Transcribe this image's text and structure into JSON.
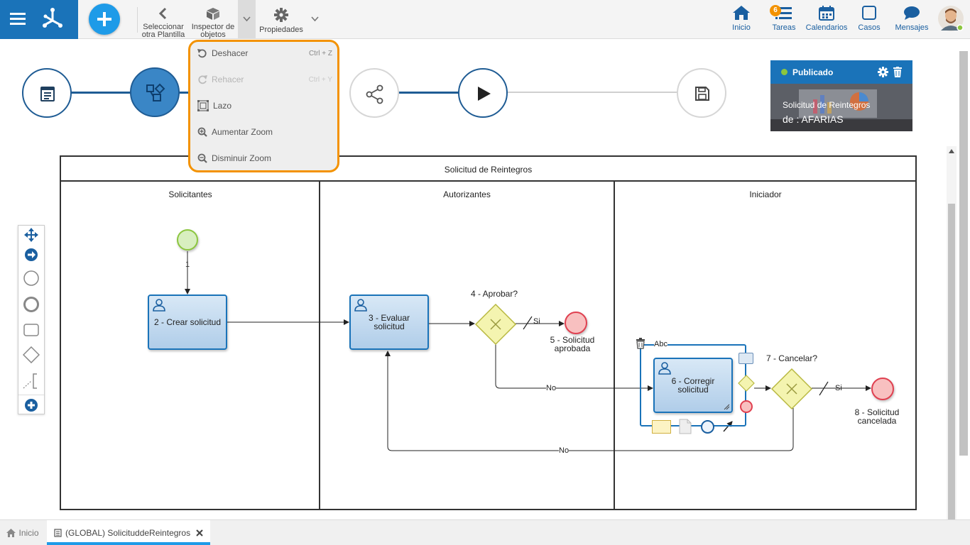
{
  "toolbar": {
    "select_template_label": "Seleccionar otra Plantilla",
    "object_inspector_label": "Inspector de objetos",
    "properties_label": "Propiedades"
  },
  "nav": {
    "home": "Inicio",
    "tasks": "Tareas",
    "tasks_badge": "6",
    "calendars": "Calendarios",
    "cases": "Casos",
    "messages": "Mensajes"
  },
  "edit_menu": {
    "items": [
      {
        "label": "Deshacer",
        "shortcut": "Ctrl + Z",
        "enabled": true
      },
      {
        "label": "Rehacer",
        "shortcut": "Ctrl + Y",
        "enabled": false
      },
      {
        "label": "Lazo",
        "shortcut": "",
        "enabled": true
      },
      {
        "label": "Aumentar Zoom",
        "shortcut": "",
        "enabled": true
      },
      {
        "label": "Disminuir Zoom",
        "shortcut": "",
        "enabled": true
      }
    ]
  },
  "publish_card": {
    "status": "Publicado",
    "title": "Solicitud de Reintegros",
    "author": "de : AFARIAS",
    "status_color": "#8cc63f"
  },
  "diagram": {
    "pool_title": "Solicitud de  Reintegros",
    "lanes": [
      "Solicitantes",
      "Autorizantes",
      "Iniciador"
    ],
    "start_event_label": "1",
    "task2": "2 - Crear solicitud",
    "task3_line1": "3 - Evaluar",
    "task3_line2": "solicitud",
    "gateway4": "4 - Aprobar?",
    "event5_line1": "5 - Solicitud",
    "event5_line2": "aprobada",
    "task6_line1": "6 - Corregir",
    "task6_line2": "solicitud",
    "gateway7": "7 - Cancelar?",
    "event8_line1": "8 - Solicitud",
    "event8_line2": "cancelada",
    "flow_si_1": "Si",
    "flow_no_1": "No",
    "flow_si_2": "Si",
    "flow_no_2": "No",
    "abc_label": "Abc"
  },
  "tabs": {
    "home_tab": "Inicio",
    "process_tab": "(GLOBAL) SolicituddeReintegros"
  },
  "colors": {
    "brand": "#1a73b9",
    "accent_orange": "#f39200",
    "task_fill": "#c5dcf0",
    "gateway_fill": "#f4f4b0",
    "end_event": "#e04050",
    "start_event": "#8cc63f"
  }
}
